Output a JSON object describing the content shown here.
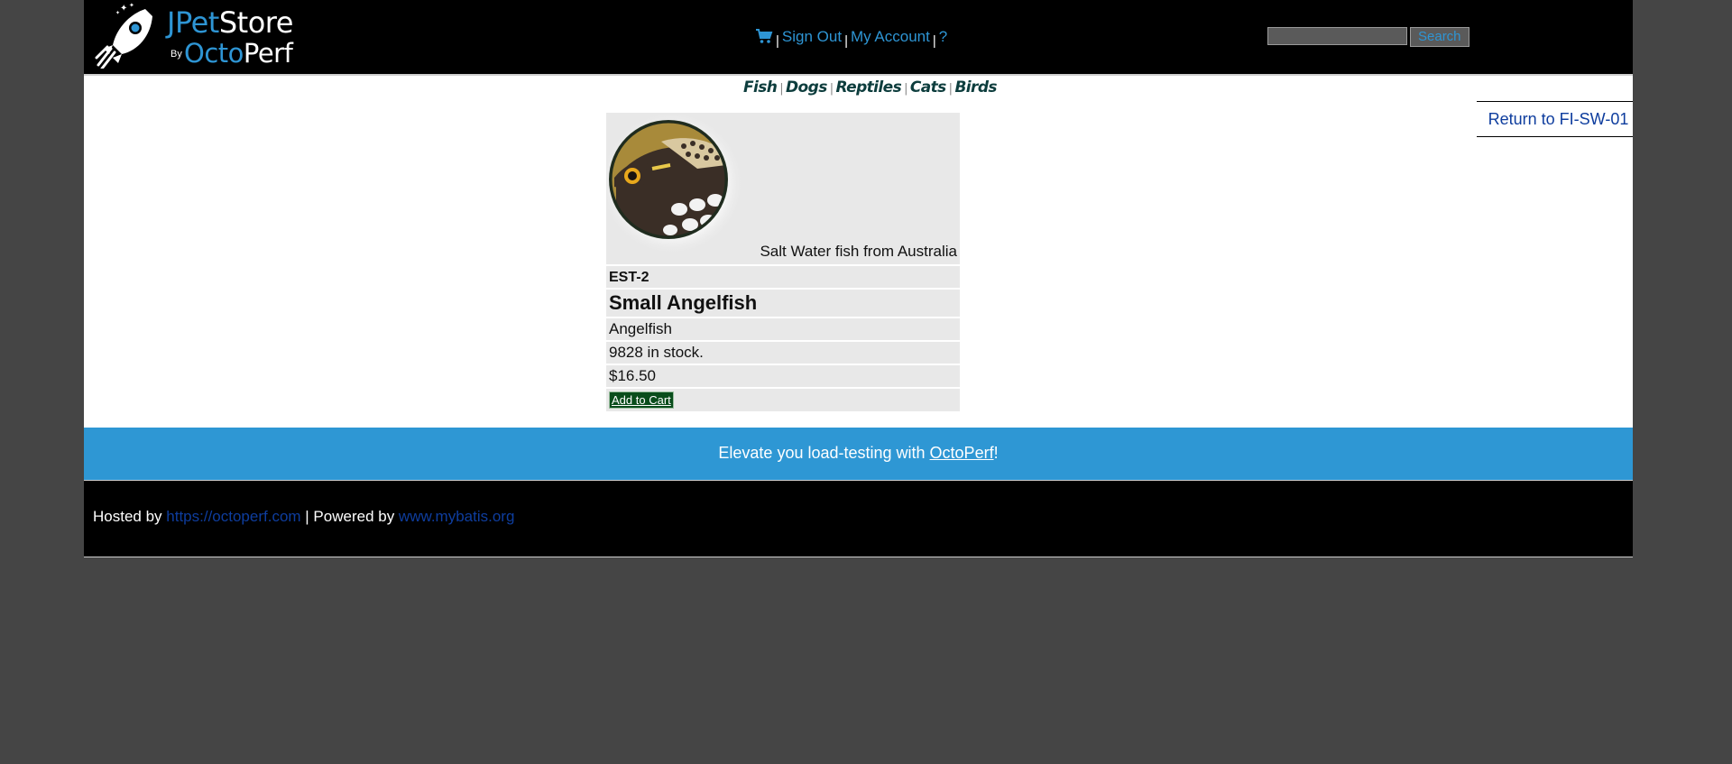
{
  "header": {
    "logo": {
      "brand_j": "JPet",
      "brand_store": "Store",
      "brand_by": "By",
      "brand_octo": "Octo",
      "brand_perf": "Perf"
    },
    "menu": {
      "cart_icon": "shopping-cart-icon",
      "sign_out": "Sign Out",
      "my_account": "My Account",
      "help": "?",
      "separator": "|"
    },
    "search": {
      "value": "",
      "placeholder": "",
      "button_label": "Search"
    }
  },
  "quicklinks": [
    {
      "label": "Fish"
    },
    {
      "label": "Dogs"
    },
    {
      "label": "Reptiles"
    },
    {
      "label": "Cats"
    },
    {
      "label": "Birds"
    }
  ],
  "back_link": "Return to FI-SW-01",
  "item": {
    "image_description": "Salt Water fish from Australia",
    "id": "EST-2",
    "name": "Small Angelfish",
    "product": "Angelfish",
    "stock": "9828 in stock.",
    "price": "$16.50",
    "add_to_cart_label": "Add to Cart"
  },
  "banner": {
    "text_before": "Elevate you load-testing with ",
    "link": "OctoPerf",
    "text_after": "!"
  },
  "footer": {
    "hosted_by": "Hosted by ",
    "hosted_link": "https://octoperf.com",
    "powered_by": " | Powered by ",
    "powered_link": "www.mybatis.org"
  },
  "colors": {
    "accent": "#2e95d4",
    "header_bg": "#000000",
    "page_bg": "#454545",
    "cart_button": "#0a4d1c",
    "link_dark": "#0e3d9e"
  }
}
